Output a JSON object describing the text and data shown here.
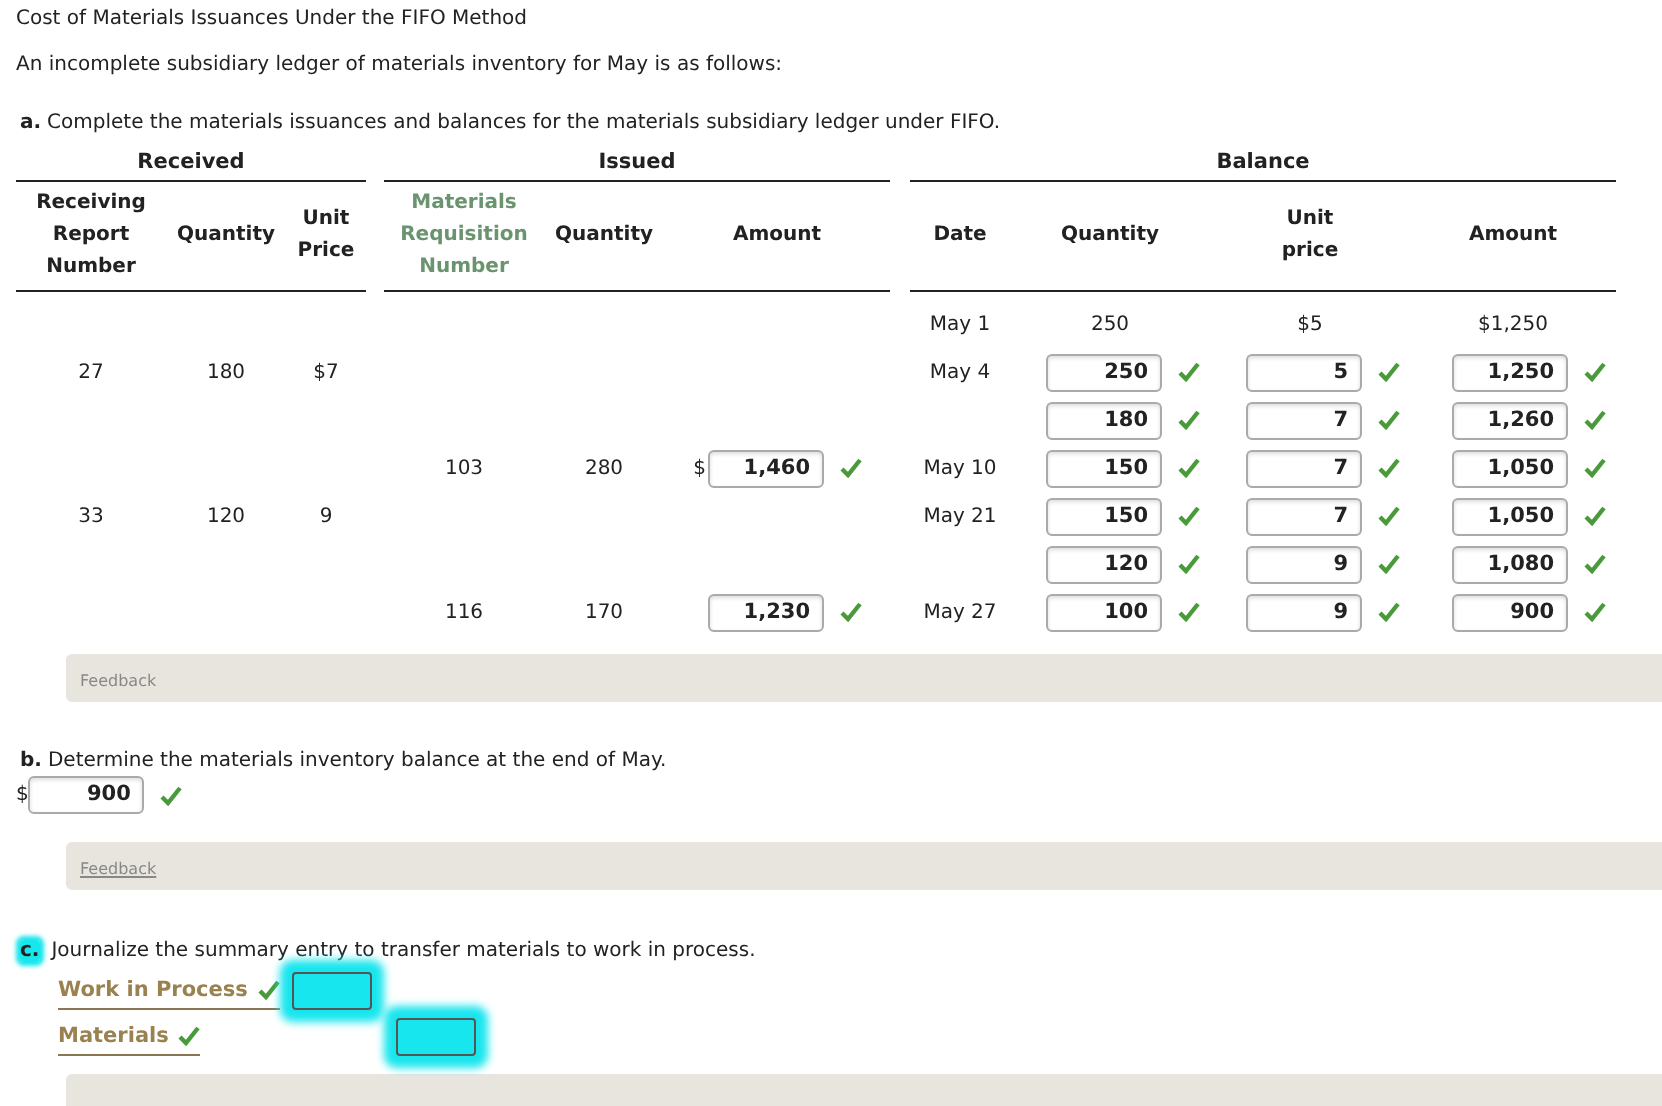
{
  "title": "Cost of Materials Issuances Under the FIFO Method",
  "intro": "An incomplete subsidiary ledger of materials inventory for May is as follows:",
  "part_a": {
    "letter": "a.",
    "text": "Complete the materials issuances and balances for the materials subsidiary ledger under FIFO.",
    "groups": [
      "Received",
      "Issued",
      "Balance"
    ],
    "columns": [
      "Receiving Report Number",
      "Quantity",
      "Unit Price",
      "Materials Requisition Number",
      "Quantity",
      "Amount",
      "Date",
      "Quantity",
      "Unit price",
      "Amount"
    ],
    "rows": [
      {
        "cells": [
          null,
          null,
          null,
          null,
          null,
          null,
          {
            "kind": "text",
            "text": "May 1"
          },
          {
            "kind": "text",
            "text": "250"
          },
          {
            "kind": "text",
            "text": "$5"
          },
          {
            "kind": "text",
            "text": "$1,250"
          }
        ]
      },
      {
        "cells": [
          {
            "kind": "text",
            "text": "27"
          },
          {
            "kind": "text",
            "text": "180"
          },
          {
            "kind": "text",
            "text": "$7"
          },
          null,
          null,
          null,
          {
            "kind": "text",
            "text": "May 4"
          },
          {
            "kind": "input",
            "text": "250",
            "correct": true
          },
          {
            "kind": "input",
            "text": "5",
            "correct": true
          },
          {
            "kind": "input",
            "text": "1,250",
            "correct": true
          }
        ]
      },
      {
        "cells": [
          null,
          null,
          null,
          null,
          null,
          null,
          null,
          {
            "kind": "input",
            "text": "180",
            "correct": true
          },
          {
            "kind": "input",
            "text": "7",
            "correct": true
          },
          {
            "kind": "input",
            "text": "1,260",
            "correct": true
          }
        ]
      },
      {
        "cells": [
          null,
          null,
          null,
          {
            "kind": "text",
            "text": "103"
          },
          {
            "kind": "text",
            "text": "280"
          },
          {
            "kind": "input",
            "text": "1,460",
            "correct": true,
            "prefix": "$"
          },
          {
            "kind": "text",
            "text": "May 10"
          },
          {
            "kind": "input",
            "text": "150",
            "correct": true
          },
          {
            "kind": "input",
            "text": "7",
            "correct": true
          },
          {
            "kind": "input",
            "text": "1,050",
            "correct": true
          }
        ]
      },
      {
        "cells": [
          {
            "kind": "text",
            "text": "33"
          },
          {
            "kind": "text",
            "text": "120"
          },
          {
            "kind": "text",
            "text": "9"
          },
          null,
          null,
          null,
          {
            "kind": "text",
            "text": "May 21"
          },
          {
            "kind": "input",
            "text": "150",
            "correct": true
          },
          {
            "kind": "input",
            "text": "7",
            "correct": true
          },
          {
            "kind": "input",
            "text": "1,050",
            "correct": true
          }
        ]
      },
      {
        "cells": [
          null,
          null,
          null,
          null,
          null,
          null,
          null,
          {
            "kind": "input",
            "text": "120",
            "correct": true
          },
          {
            "kind": "input",
            "text": "9",
            "correct": true
          },
          {
            "kind": "input",
            "text": "1,080",
            "correct": true
          }
        ]
      },
      {
        "cells": [
          null,
          null,
          null,
          {
            "kind": "text",
            "text": "116"
          },
          {
            "kind": "text",
            "text": "170"
          },
          {
            "kind": "input",
            "text": "1,230",
            "correct": true
          },
          {
            "kind": "text",
            "text": "May 27"
          },
          {
            "kind": "input",
            "text": "100",
            "correct": true
          },
          {
            "kind": "input",
            "text": "9",
            "correct": true
          },
          {
            "kind": "input",
            "text": "900",
            "correct": true
          }
        ]
      }
    ],
    "feedback": {
      "label": "Feedback",
      "underlined": false
    }
  },
  "part_b": {
    "letter": "b.",
    "text": "Determine the materials inventory balance at the end of May.",
    "answer": {
      "text": "900",
      "correct": true,
      "prefix": "$"
    },
    "feedback": {
      "label": "Feedback",
      "underlined": true
    }
  },
  "part_c": {
    "letter": "c.",
    "highlighted": true,
    "text": "Journalize the summary entry to transfer materials to work in process.",
    "entries": [
      {
        "account": "Work in Process",
        "correct": true,
        "kind": "debit",
        "highlighted": true
      },
      {
        "account": "Materials",
        "correct": true,
        "kind": "credit",
        "highlighted": true
      }
    ]
  }
}
